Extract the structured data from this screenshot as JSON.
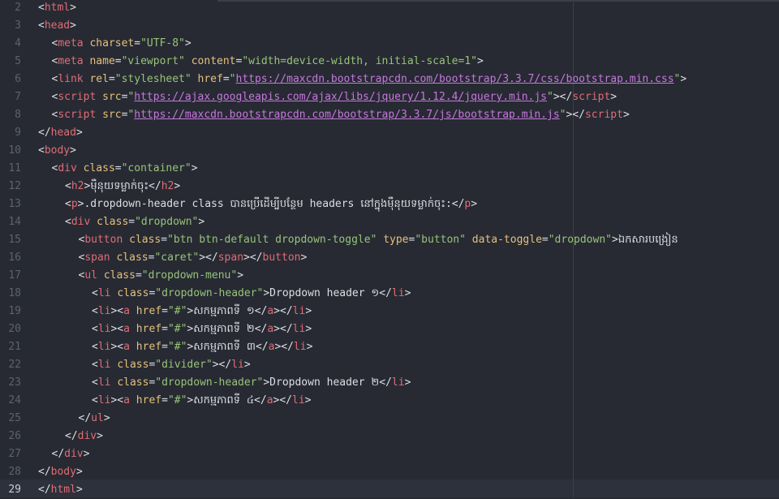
{
  "editor": {
    "lines": [
      {
        "n": "2",
        "indent": 0,
        "tokens": [
          [
            "p",
            "<"
          ],
          [
            "t",
            "html"
          ],
          [
            "p",
            ">"
          ]
        ]
      },
      {
        "n": "3",
        "indent": 0,
        "tokens": [
          [
            "p",
            "<"
          ],
          [
            "t",
            "head"
          ],
          [
            "p",
            ">"
          ]
        ]
      },
      {
        "n": "4",
        "indent": 1,
        "tokens": [
          [
            "p",
            "<"
          ],
          [
            "t",
            "meta "
          ],
          [
            "a",
            "charset"
          ],
          [
            "p",
            "="
          ],
          [
            "s",
            "\"UTF-8\""
          ],
          [
            "p",
            ">"
          ]
        ]
      },
      {
        "n": "5",
        "indent": 1,
        "tokens": [
          [
            "p",
            "<"
          ],
          [
            "t",
            "meta "
          ],
          [
            "a",
            "name"
          ],
          [
            "p",
            "="
          ],
          [
            "s",
            "\"viewport\""
          ],
          [
            "p",
            " "
          ],
          [
            "a",
            "content"
          ],
          [
            "p",
            "="
          ],
          [
            "s",
            "\"width=device-width, initial-scale=1\""
          ],
          [
            "p",
            ">"
          ]
        ]
      },
      {
        "n": "6",
        "indent": 1,
        "tokens": [
          [
            "p",
            "<"
          ],
          [
            "t",
            "link "
          ],
          [
            "a",
            "rel"
          ],
          [
            "p",
            "="
          ],
          [
            "s",
            "\"stylesheet\""
          ],
          [
            "p",
            " "
          ],
          [
            "a",
            "href"
          ],
          [
            "p",
            "="
          ],
          [
            "s",
            "\""
          ],
          [
            "u",
            "https://maxcdn.bootstrapcdn.com/bootstrap/3.3.7/css/bootstrap.min.css"
          ],
          [
            "s",
            "\""
          ],
          [
            "p",
            ">"
          ]
        ]
      },
      {
        "n": "7",
        "indent": 1,
        "tokens": [
          [
            "p",
            "<"
          ],
          [
            "t",
            "script "
          ],
          [
            "a",
            "src"
          ],
          [
            "p",
            "="
          ],
          [
            "s",
            "\""
          ],
          [
            "u",
            "https://ajax.googleapis.com/ajax/libs/jquery/1.12.4/jquery.min.js"
          ],
          [
            "s",
            "\""
          ],
          [
            "p",
            "></"
          ],
          [
            "t",
            "script"
          ],
          [
            "p",
            ">"
          ]
        ]
      },
      {
        "n": "8",
        "indent": 1,
        "tokens": [
          [
            "p",
            "<"
          ],
          [
            "t",
            "script "
          ],
          [
            "a",
            "src"
          ],
          [
            "p",
            "="
          ],
          [
            "s",
            "\""
          ],
          [
            "u",
            "https://maxcdn.bootstrapcdn.com/bootstrap/3.3.7/js/bootstrap.min.js"
          ],
          [
            "s",
            "\""
          ],
          [
            "p",
            "></"
          ],
          [
            "t",
            "script"
          ],
          [
            "p",
            ">"
          ]
        ]
      },
      {
        "n": "9",
        "indent": 0,
        "tokens": [
          [
            "p",
            "</"
          ],
          [
            "t",
            "head"
          ],
          [
            "p",
            ">"
          ]
        ]
      },
      {
        "n": "10",
        "indent": 0,
        "tokens": [
          [
            "p",
            "<"
          ],
          [
            "t",
            "body"
          ],
          [
            "p",
            ">"
          ]
        ]
      },
      {
        "n": "11",
        "indent": 1,
        "tokens": [
          [
            "p",
            "<"
          ],
          [
            "t",
            "div "
          ],
          [
            "a",
            "class"
          ],
          [
            "p",
            "="
          ],
          [
            "s",
            "\"container\""
          ],
          [
            "p",
            ">"
          ]
        ]
      },
      {
        "n": "12",
        "indent": 2,
        "tokens": [
          [
            "p",
            "<"
          ],
          [
            "t",
            "h2"
          ],
          [
            "p",
            ">"
          ],
          [
            "x",
            "ម៉ឺនុយទម្លាក់ចុះ"
          ],
          [
            "p",
            "</"
          ],
          [
            "t",
            "h2"
          ],
          [
            "p",
            ">"
          ]
        ]
      },
      {
        "n": "13",
        "indent": 2,
        "tokens": [
          [
            "p",
            "<"
          ],
          [
            "t",
            "p"
          ],
          [
            "p",
            ">"
          ],
          [
            "x",
            ".dropdown-header class បានប្រើដើម្បីបន្ថែម headers នៅក្នុងម៉ឺនុយទម្លាក់ចុះ:"
          ],
          [
            "p",
            "</"
          ],
          [
            "t",
            "p"
          ],
          [
            "p",
            ">"
          ]
        ]
      },
      {
        "n": "14",
        "indent": 2,
        "tokens": [
          [
            "p",
            "<"
          ],
          [
            "t",
            "div "
          ],
          [
            "a",
            "class"
          ],
          [
            "p",
            "="
          ],
          [
            "s",
            "\"dropdown\""
          ],
          [
            "p",
            ">"
          ]
        ]
      },
      {
        "n": "15",
        "indent": 3,
        "tokens": [
          [
            "p",
            "<"
          ],
          [
            "t",
            "button "
          ],
          [
            "a",
            "class"
          ],
          [
            "p",
            "="
          ],
          [
            "s",
            "\"btn btn-default dropdown-toggle\""
          ],
          [
            "p",
            " "
          ],
          [
            "a",
            "type"
          ],
          [
            "p",
            "="
          ],
          [
            "s",
            "\"button\""
          ],
          [
            "p",
            " "
          ],
          [
            "a",
            "data-toggle"
          ],
          [
            "p",
            "="
          ],
          [
            "s",
            "\"dropdown\""
          ],
          [
            "p",
            ">"
          ],
          [
            "x",
            "ឯកសារបង្រៀន"
          ]
        ]
      },
      {
        "n": "16",
        "indent": 3,
        "tokens": [
          [
            "p",
            "<"
          ],
          [
            "t",
            "span "
          ],
          [
            "a",
            "class"
          ],
          [
            "p",
            "="
          ],
          [
            "s",
            "\"caret\""
          ],
          [
            "p",
            "></"
          ],
          [
            "t",
            "span"
          ],
          [
            "p",
            "></"
          ],
          [
            "t",
            "button"
          ],
          [
            "p",
            ">"
          ]
        ]
      },
      {
        "n": "17",
        "indent": 3,
        "tokens": [
          [
            "p",
            "<"
          ],
          [
            "t",
            "ul "
          ],
          [
            "a",
            "class"
          ],
          [
            "p",
            "="
          ],
          [
            "s",
            "\"dropdown-menu\""
          ],
          [
            "p",
            ">"
          ]
        ]
      },
      {
        "n": "18",
        "indent": 4,
        "tokens": [
          [
            "p",
            "<"
          ],
          [
            "t",
            "li "
          ],
          [
            "a",
            "class"
          ],
          [
            "p",
            "="
          ],
          [
            "s",
            "\"dropdown-header\""
          ],
          [
            "p",
            ">"
          ],
          [
            "x",
            "Dropdown header ១"
          ],
          [
            "p",
            "</"
          ],
          [
            "t",
            "li"
          ],
          [
            "p",
            ">"
          ]
        ]
      },
      {
        "n": "19",
        "indent": 4,
        "tokens": [
          [
            "p",
            "<"
          ],
          [
            "t",
            "li"
          ],
          [
            "p",
            "><"
          ],
          [
            "t",
            "a "
          ],
          [
            "a",
            "href"
          ],
          [
            "p",
            "="
          ],
          [
            "s",
            "\"#\""
          ],
          [
            "p",
            ">"
          ],
          [
            "x",
            "សកម្មភាពទី ១"
          ],
          [
            "p",
            "</"
          ],
          [
            "t",
            "a"
          ],
          [
            "p",
            "></"
          ],
          [
            "t",
            "li"
          ],
          [
            "p",
            ">"
          ]
        ]
      },
      {
        "n": "20",
        "indent": 4,
        "tokens": [
          [
            "p",
            "<"
          ],
          [
            "t",
            "li"
          ],
          [
            "p",
            "><"
          ],
          [
            "t",
            "a "
          ],
          [
            "a",
            "href"
          ],
          [
            "p",
            "="
          ],
          [
            "s",
            "\"#\""
          ],
          [
            "p",
            ">"
          ],
          [
            "x",
            "សកម្មភាពទី ២"
          ],
          [
            "p",
            "</"
          ],
          [
            "t",
            "a"
          ],
          [
            "p",
            "></"
          ],
          [
            "t",
            "li"
          ],
          [
            "p",
            ">"
          ]
        ]
      },
      {
        "n": "21",
        "indent": 4,
        "tokens": [
          [
            "p",
            "<"
          ],
          [
            "t",
            "li"
          ],
          [
            "p",
            "><"
          ],
          [
            "t",
            "a "
          ],
          [
            "a",
            "href"
          ],
          [
            "p",
            "="
          ],
          [
            "s",
            "\"#\""
          ],
          [
            "p",
            ">"
          ],
          [
            "x",
            "សកម្មភាពទី ៣"
          ],
          [
            "p",
            "</"
          ],
          [
            "t",
            "a"
          ],
          [
            "p",
            "></"
          ],
          [
            "t",
            "li"
          ],
          [
            "p",
            ">"
          ]
        ]
      },
      {
        "n": "22",
        "indent": 4,
        "tokens": [
          [
            "p",
            "<"
          ],
          [
            "t",
            "li "
          ],
          [
            "a",
            "class"
          ],
          [
            "p",
            "="
          ],
          [
            "s",
            "\"divider\""
          ],
          [
            "p",
            "></"
          ],
          [
            "t",
            "li"
          ],
          [
            "p",
            ">"
          ]
        ]
      },
      {
        "n": "23",
        "indent": 4,
        "tokens": [
          [
            "p",
            "<"
          ],
          [
            "t",
            "li "
          ],
          [
            "a",
            "class"
          ],
          [
            "p",
            "="
          ],
          [
            "s",
            "\"dropdown-header\""
          ],
          [
            "p",
            ">"
          ],
          [
            "x",
            "Dropdown header ២"
          ],
          [
            "p",
            "</"
          ],
          [
            "t",
            "li"
          ],
          [
            "p",
            ">"
          ]
        ]
      },
      {
        "n": "24",
        "indent": 4,
        "tokens": [
          [
            "p",
            "<"
          ],
          [
            "t",
            "li"
          ],
          [
            "p",
            "><"
          ],
          [
            "t",
            "a "
          ],
          [
            "a",
            "href"
          ],
          [
            "p",
            "="
          ],
          [
            "s",
            "\"#\""
          ],
          [
            "p",
            ">"
          ],
          [
            "x",
            "សកម្មភាពទី ៤"
          ],
          [
            "p",
            "</"
          ],
          [
            "t",
            "a"
          ],
          [
            "p",
            "></"
          ],
          [
            "t",
            "li"
          ],
          [
            "p",
            ">"
          ]
        ]
      },
      {
        "n": "25",
        "indent": 3,
        "tokens": [
          [
            "p",
            "</"
          ],
          [
            "t",
            "ul"
          ],
          [
            "p",
            ">"
          ]
        ]
      },
      {
        "n": "26",
        "indent": 2,
        "tokens": [
          [
            "p",
            "</"
          ],
          [
            "t",
            "div"
          ],
          [
            "p",
            ">"
          ]
        ]
      },
      {
        "n": "27",
        "indent": 1,
        "tokens": [
          [
            "p",
            "</"
          ],
          [
            "t",
            "div"
          ],
          [
            "p",
            ">"
          ]
        ]
      },
      {
        "n": "28",
        "indent": 0,
        "tokens": [
          [
            "p",
            "</"
          ],
          [
            "t",
            "body"
          ],
          [
            "p",
            ">"
          ]
        ]
      },
      {
        "n": "29",
        "indent": 0,
        "tokens": [
          [
            "p",
            "</"
          ],
          [
            "t",
            "html"
          ],
          [
            "p",
            ">"
          ]
        ]
      }
    ],
    "active_line": "29",
    "colors": {
      "background": "#272a33",
      "tag": "#e06c75",
      "attribute": "#e5c07b",
      "string": "#98c379",
      "url": "#c678dd",
      "text": "#dcdfe4",
      "line_number": "#5b6270"
    }
  }
}
